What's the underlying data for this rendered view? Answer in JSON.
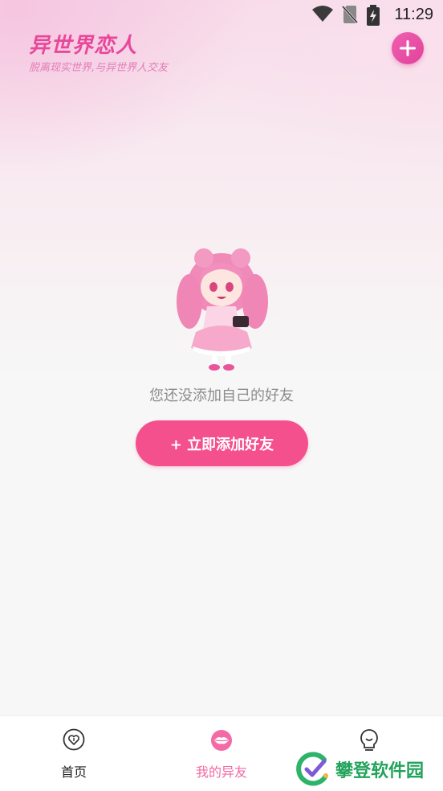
{
  "status_bar": {
    "time": "11:29",
    "icons": [
      "wifi-icon",
      "no-sim-icon",
      "battery-charging-icon"
    ]
  },
  "header": {
    "title": "异世界恋人",
    "subtitle": "脱离现实世界,与异世界人交友",
    "add_icon": "plus-icon"
  },
  "empty_state": {
    "illustration": "anime-girl-mascot",
    "message": "您还没添加自己的好友",
    "button_label": "+ 立即添加好友"
  },
  "bottom_nav": {
    "items": [
      {
        "label": "首页",
        "icon": "heart-outline-icon",
        "active": false
      },
      {
        "label": "我的异友",
        "icon": "lips-icon",
        "active": true
      },
      {
        "label": "",
        "icon": "lightbulb-icon",
        "active": false
      }
    ]
  },
  "watermark": {
    "text": "攀登软件园"
  },
  "colors": {
    "accent": "#f4508d",
    "title": "#e8479a",
    "active_nav": "#f06aa4"
  }
}
